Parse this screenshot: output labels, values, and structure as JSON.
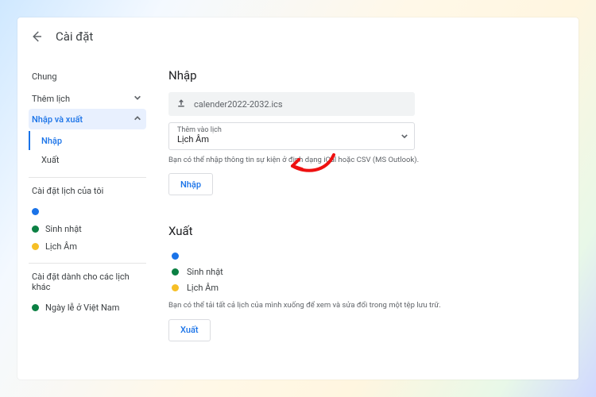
{
  "header": {
    "title": "Cài đặt"
  },
  "sidebar": {
    "general_label": "Chung",
    "add_calendar_label": "Thêm lịch",
    "import_export_label": "Nhập và xuất",
    "sub": {
      "import": "Nhập",
      "export": "Xuất"
    },
    "my_settings_label": "Cài đặt lịch của tôi",
    "my_calendars": [
      {
        "color": "#1a73e8",
        "name": ""
      },
      {
        "color": "#0b8043",
        "name": "Sinh nhật"
      },
      {
        "color": "#f6bf26",
        "name": "Lịch Âm"
      }
    ],
    "other_settings_label": "Cài đặt dành cho các lịch khác",
    "other_calendars": [
      {
        "color": "#0b8043",
        "name": "Ngày lễ ở Việt Nam"
      }
    ]
  },
  "import_section": {
    "title": "Nhập",
    "file_name": "calender2022-2032.ics",
    "add_to_label": "Thêm vào lịch",
    "add_to_value": "Lịch Âm",
    "hint": "Bạn có thể nhập thông tin sự kiện ở định dạng iCal hoặc CSV (MS Outlook).",
    "button": "Nhập"
  },
  "export_section": {
    "title": "Xuất",
    "calendars": [
      {
        "color": "#1a73e8",
        "name": ""
      },
      {
        "color": "#0b8043",
        "name": "Sinh nhật"
      },
      {
        "color": "#f6bf26",
        "name": "Lịch Âm"
      }
    ],
    "hint": "Bạn có thể tải tất cả lịch của mình xuống để xem và sửa đổi trong một tệp lưu trữ.",
    "button": "Xuất"
  },
  "colors": {
    "blue": "#1a73e8",
    "green": "#0b8043",
    "yellow": "#f6bf26"
  }
}
